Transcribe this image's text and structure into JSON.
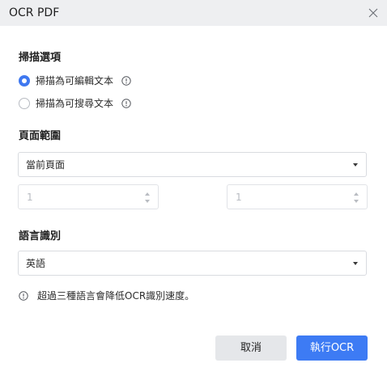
{
  "window": {
    "title": "OCR PDF"
  },
  "scan_options": {
    "heading": "掃描選項",
    "options": [
      {
        "label": "掃描為可編輯文本",
        "checked": true
      },
      {
        "label": "掃描為可搜尋文本",
        "checked": false
      }
    ]
  },
  "page_range": {
    "heading": "頁面範圍",
    "selected": "當前頁面",
    "from_value": "1",
    "to_value": "1"
  },
  "language": {
    "heading": "語言識別",
    "selected": "英語",
    "note": "超過三種語言會降低OCR識別速度。"
  },
  "footer": {
    "cancel_label": "取消",
    "run_label": "執行OCR"
  },
  "colors": {
    "accent": "#3d7bf4",
    "titlebar": "#eeeff1",
    "cancel_bg": "#e5e7ea"
  },
  "icons": {
    "close": "close-icon",
    "info": "info-icon",
    "dropdown": "chevron-down-icon"
  }
}
